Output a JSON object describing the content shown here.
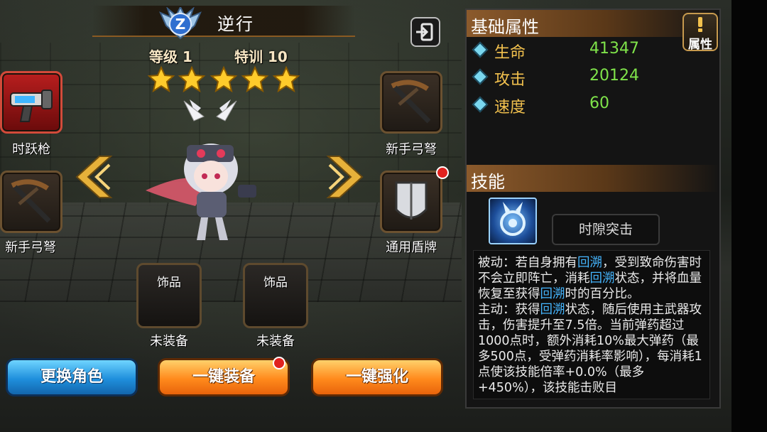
{
  "header": {
    "character_name": "逆行",
    "level_label": "等级 1",
    "training_label": "特训 10",
    "star_count": 5,
    "rank_badge_letter": "Z"
  },
  "equipment": {
    "main_weapon": {
      "label": "时跃枪",
      "icon": "cannon-icon"
    },
    "left_sub": {
      "label": "新手弓弩",
      "icon": "crossbow-icon"
    },
    "right_top": {
      "label": "新手弓弩",
      "icon": "crossbow-icon"
    },
    "right_bottom": {
      "label": "通用盾牌",
      "icon": "shield-icon",
      "has_alert": true
    },
    "accessory_1": {
      "label": "未装备",
      "slot_text": "饰品"
    },
    "accessory_2": {
      "label": "未装备",
      "slot_text": "饰品"
    }
  },
  "buttons": {
    "change_character": "更换角色",
    "one_click_equip": "一键装备",
    "one_click_enhance": "一键强化"
  },
  "stats_panel": {
    "title": "基础属性",
    "attr_button": "属性",
    "stats": [
      {
        "name": "生命",
        "value": "41347"
      },
      {
        "name": "攻击",
        "value": "20124"
      },
      {
        "name": "速度",
        "value": "60"
      }
    ]
  },
  "skills_panel": {
    "title": "技能",
    "skill_name": "时隙突击",
    "desc": {
      "p1_a": "被动：若自身拥有",
      "p1_b": "回溯",
      "p1_c": "，受到致命伤害时不会立即阵亡，消耗",
      "p1_d": "回溯",
      "p1_e": "状态，并将血量恢复至获得",
      "p1_f": "回溯",
      "p1_g": "时的百分比。",
      "p2_a": "主动：获得",
      "p2_b": "回溯",
      "p2_c": "状态，随后使用主武器攻击，伤害提升至7.5倍。当前弹药超过1000点时，额外消耗10%最大弹药（最多500点，受弹药消耗率影响），每消耗1点使该技能倍率+0.0%（最多+450%），该技能击败目"
    }
  },
  "colors": {
    "stat_name": "#f2c14e",
    "stat_value": "#7fe34a",
    "highlight": "#45b6ff",
    "alert": "#e0221f"
  }
}
